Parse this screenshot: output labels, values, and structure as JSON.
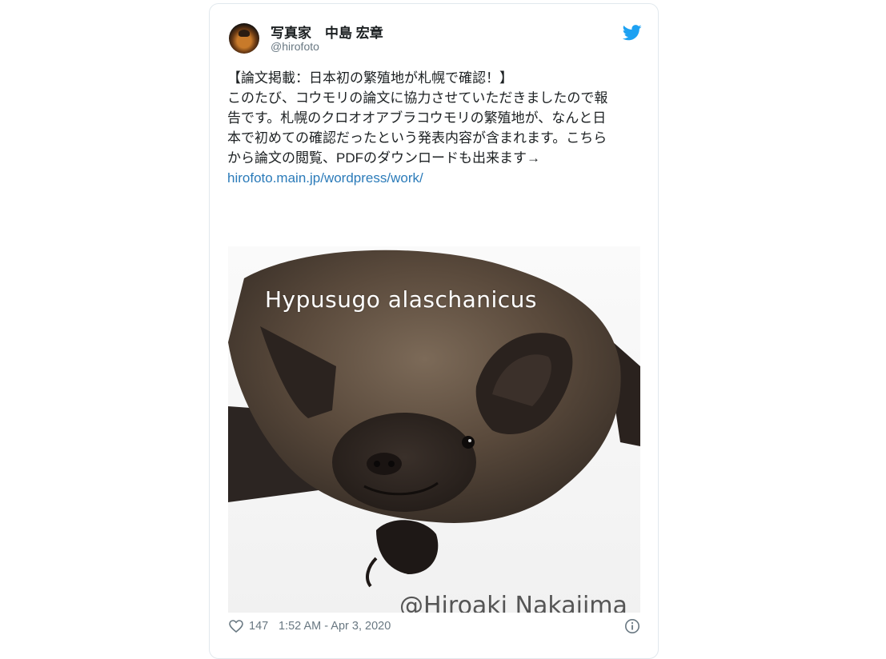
{
  "tweet": {
    "display_name": "写真家　中島 宏章",
    "handle": "@hirofoto",
    "text_lines": [
      "【論文掲載：日本初の繁殖地が札幌で確認！】",
      "このたび、コウモリの論文に協力させていただきましたので報",
      "告です。札幌のクロオオアブラコウモリの繁殖地が、なんと日",
      "本で初めての確認だったという発表内容が含まれます。こちら",
      "から論文の閲覧、PDFのダウンロードも出来ます→"
    ],
    "link": "hirofoto.main.jp/wordpress/work/",
    "media": {
      "caption": "Hypusugo alaschanicus",
      "watermark": "@Hiroaki Nakajima"
    },
    "like_count": "147",
    "timestamp": "1:52 AM - Apr 3, 2020"
  },
  "icons": {
    "avatar": "avatar-photo",
    "brand": "twitter-bird-icon",
    "like": "heart-icon",
    "info": "info-icon"
  },
  "colors": {
    "brand": "#1da1f2",
    "link": "#2b7bb9",
    "text": "#1c2022",
    "muted": "#697882",
    "border": "#e1e8ed"
  }
}
